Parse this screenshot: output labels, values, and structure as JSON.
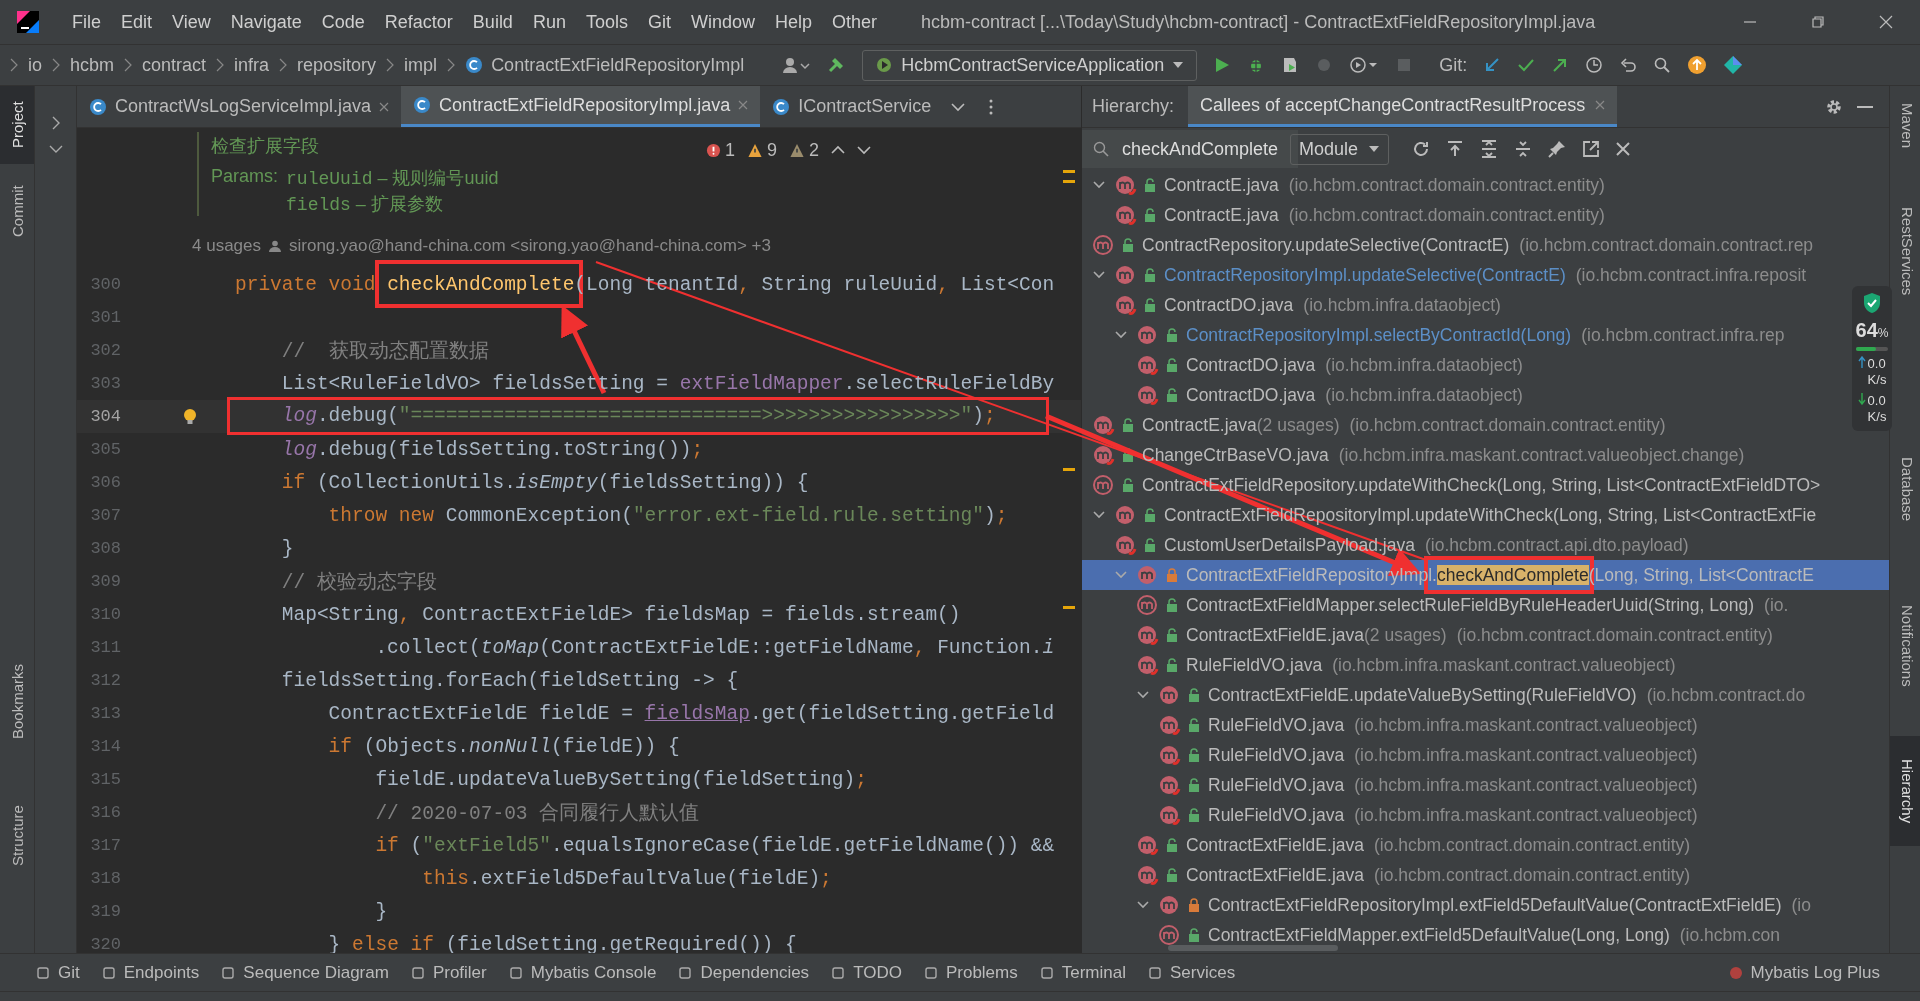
{
  "menu": {
    "items": [
      "File",
      "Edit",
      "View",
      "Navigate",
      "Code",
      "Refactor",
      "Build",
      "Run",
      "Tools",
      "Git",
      "Window",
      "Help",
      "Other"
    ],
    "title": "hcbm-contract [...\\Today\\Study\\hcbm-contract] - ContractExtFieldRepositoryImpl.java"
  },
  "breadcrumbs": [
    "io",
    "hcbm",
    "contract",
    "infra",
    "repository",
    "impl",
    "ContractExtFieldRepositoryImpl"
  ],
  "run_config": "HcbmContractServiceApplication",
  "git_label": "Git:",
  "left_tools": [
    {
      "label": "Project",
      "selected": true
    },
    {
      "label": "Commit",
      "selected": false
    },
    {
      "label": "Bookmarks",
      "selected": false
    },
    {
      "label": "Structure",
      "selected": false
    }
  ],
  "right_tools": [
    {
      "label": "Maven",
      "selected": false
    },
    {
      "label": "RestServices",
      "selected": false
    },
    {
      "label": "Database",
      "selected": false
    },
    {
      "label": "Notifications",
      "selected": false
    },
    {
      "label": "Hierarchy",
      "selected": true
    }
  ],
  "editor": {
    "tabs": [
      {
        "label": "ContractWsLogServiceImpl.java",
        "selected": false,
        "closable": true
      },
      {
        "label": "ContractExtFieldRepositoryImpl.java",
        "selected": true,
        "closable": true
      },
      {
        "label": "IContractService",
        "selected": false,
        "closable": false
      }
    ],
    "doc": {
      "title": "检查扩展字段",
      "params_label": "Params:",
      "params": [
        {
          "name": "ruleUuid",
          "desc": " – 规则编号uuid"
        },
        {
          "name": "fields",
          "desc": " – 扩展参数"
        }
      ]
    },
    "inspections": {
      "errors": "1",
      "warnings": "9",
      "weak": "2"
    },
    "usages": "4 usages",
    "author": "sirong.yao@hand-china.com <sirong.yao@hand-china.com> +3",
    "lines": [
      {
        "number": "300",
        "current": false,
        "tokens": [
          {
            "kind": "kw",
            "text": "private void "
          },
          {
            "kind": "fn",
            "text": "checkAndComplete"
          },
          {
            "kind": "plain",
            "text": "(Long tenantId"
          },
          {
            "kind": "kw",
            "text": ", "
          },
          {
            "kind": "plain",
            "text": "String ruleUuid"
          },
          {
            "kind": "kw",
            "text": ", "
          },
          {
            "kind": "plain",
            "text": "List<Con"
          }
        ]
      },
      {
        "number": "301",
        "current": false
      },
      {
        "number": "302",
        "current": false,
        "tokens": [
          {
            "kind": "cmt",
            "text": "    //  获取动态配置数据"
          }
        ]
      },
      {
        "number": "303",
        "current": false,
        "tokens": [
          {
            "kind": "plain",
            "text": "    List<RuleFieldVO> fieldsSetting = "
          },
          {
            "kind": "fld",
            "text": "extFieldMapper"
          },
          {
            "kind": "plain",
            "text": ".selectRuleFieldBy"
          }
        ]
      },
      {
        "number": "304",
        "current": true,
        "tokens": [
          {
            "kind": "itf",
            "text": "    log"
          },
          {
            "kind": "plain",
            "text": ".debug("
          },
          {
            "kind": "str",
            "text": "\"==============================>>>>>>>>>>>>>>>>>\""
          },
          {
            "kind": "plain",
            "text": ")"
          },
          {
            "kind": "kw",
            "text": ";"
          }
        ]
      },
      {
        "number": "305",
        "current": false,
        "tokens": [
          {
            "kind": "itf",
            "text": "    log"
          },
          {
            "kind": "plain",
            "text": ".debug(fieldsSetting.toString())"
          },
          {
            "kind": "kw",
            "text": ";"
          }
        ]
      },
      {
        "number": "306",
        "current": false,
        "tokens": [
          {
            "kind": "kw",
            "text": "    if "
          },
          {
            "kind": "plain",
            "text": "(CollectionUtils."
          },
          {
            "kind": "it",
            "text": "isEmpty"
          },
          {
            "kind": "plain",
            "text": "(fieldsSetting)) {"
          }
        ]
      },
      {
        "number": "307",
        "current": false,
        "tokens": [
          {
            "kind": "kw",
            "text": "        throw new "
          },
          {
            "kind": "plain",
            "text": "CommonException("
          },
          {
            "kind": "str",
            "text": "\"error.ext-field.rule.setting\""
          },
          {
            "kind": "plain",
            "text": ")"
          },
          {
            "kind": "kw",
            "text": ";"
          }
        ]
      },
      {
        "number": "308",
        "current": false,
        "tokens": [
          {
            "kind": "plain",
            "text": "    }"
          }
        ]
      },
      {
        "number": "309",
        "current": false,
        "tokens": [
          {
            "kind": "cmt",
            "text": "    // 校验动态字段"
          }
        ]
      },
      {
        "number": "310",
        "current": false,
        "tokens": [
          {
            "kind": "plain",
            "text": "    Map<String"
          },
          {
            "kind": "kw",
            "text": ", "
          },
          {
            "kind": "plain",
            "text": "ContractExtFieldE> fieldsMap = fields.stream()"
          }
        ]
      },
      {
        "number": "311",
        "current": false,
        "tokens": [
          {
            "kind": "plain",
            "text": "            .collect("
          },
          {
            "kind": "it",
            "text": "toMap"
          },
          {
            "kind": "plain",
            "text": "(ContractExtFieldE::getFieldName"
          },
          {
            "kind": "kw",
            "text": ", "
          },
          {
            "kind": "plain",
            "text": "Function."
          },
          {
            "kind": "it",
            "text": "i"
          }
        ]
      },
      {
        "number": "312",
        "current": false,
        "tokens": [
          {
            "kind": "plain",
            "text": "    fieldsSetting.forEach(fieldSetting -> {"
          }
        ]
      },
      {
        "number": "313",
        "current": false,
        "tokens": [
          {
            "kind": "plain",
            "text": "        ContractExtFieldE fieldE = "
          },
          {
            "kind": "und",
            "text": "fieldsMap"
          },
          {
            "kind": "plain",
            "text": ".get(fieldSetting.getField"
          }
        ]
      },
      {
        "number": "314",
        "current": false,
        "tokens": [
          {
            "kind": "kw",
            "text": "        if "
          },
          {
            "kind": "plain",
            "text": "(Objects."
          },
          {
            "kind": "it",
            "text": "nonNull"
          },
          {
            "kind": "plain",
            "text": "(fieldE)) {"
          }
        ]
      },
      {
        "number": "315",
        "current": false,
        "tokens": [
          {
            "kind": "plain",
            "text": "            fieldE.updateValueBySetting(fieldSetting)"
          },
          {
            "kind": "kw",
            "text": ";"
          }
        ]
      },
      {
        "number": "316",
        "current": false,
        "tokens": [
          {
            "kind": "cmt",
            "text": "            // 2020-07-03 合同履行人默认值"
          }
        ]
      },
      {
        "number": "317",
        "current": false,
        "tokens": [
          {
            "kind": "kw",
            "text": "            if "
          },
          {
            "kind": "plain",
            "text": "("
          },
          {
            "kind": "str",
            "text": "\"extField5\""
          },
          {
            "kind": "plain",
            "text": ".equalsIgnoreCase(fieldE.getFieldName()) &&"
          }
        ]
      },
      {
        "number": "318",
        "current": false,
        "tokens": [
          {
            "kind": "kw",
            "text": "                this"
          },
          {
            "kind": "plain",
            "text": ".extField5DefaultValue(fieldE)"
          },
          {
            "kind": "kw",
            "text": ";"
          }
        ]
      },
      {
        "number": "319",
        "current": false,
        "tokens": [
          {
            "kind": "plain",
            "text": "            }"
          }
        ]
      },
      {
        "number": "320",
        "current": false,
        "tokens": [
          {
            "kind": "plain",
            "text": "        } "
          },
          {
            "kind": "kw",
            "text": "else if "
          },
          {
            "kind": "plain",
            "text": "(fieldSetting.getRequired()) {"
          }
        ]
      }
    ]
  },
  "hierarchy": {
    "label": "Hierarchy:",
    "tab": "Callees of acceptChangeContractResultProcess",
    "search": "checkAndComplete",
    "scope": "Module",
    "tree": [
      {
        "kind": "bean",
        "private": false,
        "name": "ContractE.java",
        "package": "(io.hcbm.contract.domain.contract.entity)",
        "color": "#bbbbbb",
        "selected": false,
        "expanded": true,
        "children": [
          {
            "kind": "bean",
            "private": false,
            "name": "ContractE.java",
            "package": "(io.hcbm.contract.domain.contract.entity)",
            "color": "#bbbbbb",
            "selected": false
          }
        ]
      },
      {
        "kind": "interface",
        "private": false,
        "name": "ContractRepository.updateSelective(ContractE)",
        "package": "(io.hcbm.contract.domain.contract.rep",
        "color": "#bbbbbb",
        "selected": false
      },
      {
        "kind": "method",
        "private": false,
        "name": "ContractRepositoryImpl.updateSelective(ContractE)",
        "package": "(io.hcbm.contract.infra.reposit",
        "color": "#5c8fc7",
        "selected": false,
        "expanded": true,
        "children": [
          {
            "kind": "bean",
            "private": false,
            "name": "ContractDO.java",
            "package": "(io.hcbm.infra.dataobject)",
            "color": "#bbbbbb",
            "selected": false
          },
          {
            "kind": "method",
            "private": false,
            "name": "ContractRepositoryImpl.selectByContractId(Long)",
            "package": "(io.hcbm.contract.infra.rep",
            "color": "#5c8fc7",
            "selected": false,
            "expanded": true,
            "children": [
              {
                "kind": "bean",
                "private": false,
                "name": "ContractDO.java",
                "package": "(io.hcbm.infra.dataobject)",
                "color": "#bbbbbb",
                "selected": false
              },
              {
                "kind": "bean",
                "private": false,
                "name": "ContractDO.java",
                "package": "(io.hcbm.infra.dataobject)",
                "color": "#bbbbbb",
                "selected": false
              }
            ]
          }
        ]
      },
      {
        "kind": "bean",
        "private": false,
        "name": "ContractE.java",
        "usages": "(2 usages)",
        "package": "(io.hcbm.contract.domain.contract.entity)",
        "color": "#bbbbbb",
        "selected": false
      },
      {
        "kind": "bean",
        "private": false,
        "name": "ChangeCtrBaseVO.java",
        "package": "(io.hcbm.infra.maskant.contract.valueobject.change)",
        "color": "#bbbbbb",
        "selected": false
      },
      {
        "kind": "interface",
        "private": false,
        "name": "ContractExtFieldRepository.updateWithCheck(Long, String, List<ContractExtFieldDTO>",
        "color": "#bbbbbb",
        "selected": false
      },
      {
        "kind": "method",
        "private": false,
        "name": "ContractExtFieldRepositoryImpl.updateWithCheck(Long, String, List<ContractExtFie",
        "color": "#bbbbbb",
        "selected": false,
        "expanded": true,
        "children": [
          {
            "kind": "bean",
            "private": false,
            "name": "CustomUserDetailsPayload.java",
            "package": "(io.hcbm.contract.api.dto.payload)",
            "color": "#bbbbbb",
            "selected": false
          },
          {
            "kind": "method",
            "private": true,
            "name": "ContractExtFieldRepositoryImpl.",
            "match": "checkAndComplete",
            "tail": "(Long, String, List<ContractE",
            "color": "#bbbbbb",
            "selected": true,
            "expanded": true,
            "children": [
              {
                "kind": "interface",
                "private": false,
                "name": "ContractExtFieldMapper.selectRuleFieldByRuleHeaderUuid(String, Long)",
                "package": "(io.",
                "color": "#bbbbbb",
                "selected": false
              },
              {
                "kind": "bean",
                "private": false,
                "name": "ContractExtFieldE.java",
                "usages": "(2 usages)",
                "package": "(io.hcbm.contract.domain.contract.entity)",
                "color": "#bbbbbb",
                "selected": false
              },
              {
                "kind": "bean",
                "private": false,
                "name": "RuleFieldVO.java",
                "package": "(io.hcbm.infra.maskant.contract.valueobject)",
                "color": "#bbbbbb",
                "selected": false
              },
              {
                "kind": "method",
                "private": false,
                "name": "ContractExtFieldE.updateValueBySetting(RuleFieldVO)",
                "package": "(io.hcbm.contract.do",
                "color": "#bbbbbb",
                "selected": false,
                "expanded": true,
                "children": [
                  {
                    "kind": "bean",
                    "private": false,
                    "name": "RuleFieldVO.java",
                    "package": "(io.hcbm.infra.maskant.contract.valueobject)",
                    "color": "#bbbbbb",
                    "selected": false
                  },
                  {
                    "kind": "bean",
                    "private": false,
                    "name": "RuleFieldVO.java",
                    "package": "(io.hcbm.infra.maskant.contract.valueobject)",
                    "color": "#bbbbbb",
                    "selected": false
                  },
                  {
                    "kind": "bean",
                    "private": false,
                    "name": "RuleFieldVO.java",
                    "package": "(io.hcbm.infra.maskant.contract.valueobject)",
                    "color": "#bbbbbb",
                    "selected": false
                  },
                  {
                    "kind": "bean",
                    "private": false,
                    "name": "RuleFieldVO.java",
                    "package": "(io.hcbm.infra.maskant.contract.valueobject)",
                    "color": "#bbbbbb",
                    "selected": false
                  }
                ]
              },
              {
                "kind": "bean",
                "private": false,
                "name": "ContractExtFieldE.java",
                "package": "(io.hcbm.contract.domain.contract.entity)",
                "color": "#bbbbbb",
                "selected": false
              },
              {
                "kind": "bean",
                "private": false,
                "name": "ContractExtFieldE.java",
                "package": "(io.hcbm.contract.domain.contract.entity)",
                "color": "#bbbbbb",
                "selected": false
              },
              {
                "kind": "method",
                "private": true,
                "name": "ContractExtFieldRepositoryImpl.extField5DefaultValue(ContractExtFieldE)",
                "package": "(io",
                "color": "#bbbbbb",
                "selected": false,
                "expanded": true,
                "children": [
                  {
                    "kind": "interface",
                    "private": false,
                    "name": "ContractExtFieldMapper.extField5DefaultValue(Long, Long)",
                    "package": "(io.hcbm.con",
                    "color": "#bbbbbb",
                    "selected": false
                  }
                ]
              }
            ]
          }
        ]
      }
    ]
  },
  "monitor": {
    "percent": "64",
    "unit": "%",
    "level": 0.64,
    "up": "0.0",
    "up_unit": "K/s",
    "down": "0.0",
    "down_unit": "K/s"
  },
  "bottom_tools": [
    "Git",
    "Endpoints",
    "Sequence Diagram",
    "Profiler",
    "Mybatis Console",
    "Dependencies",
    "TODO",
    "Problems",
    "Terminal",
    "Services"
  ],
  "bottom_right": "Mybatis Log Plus"
}
